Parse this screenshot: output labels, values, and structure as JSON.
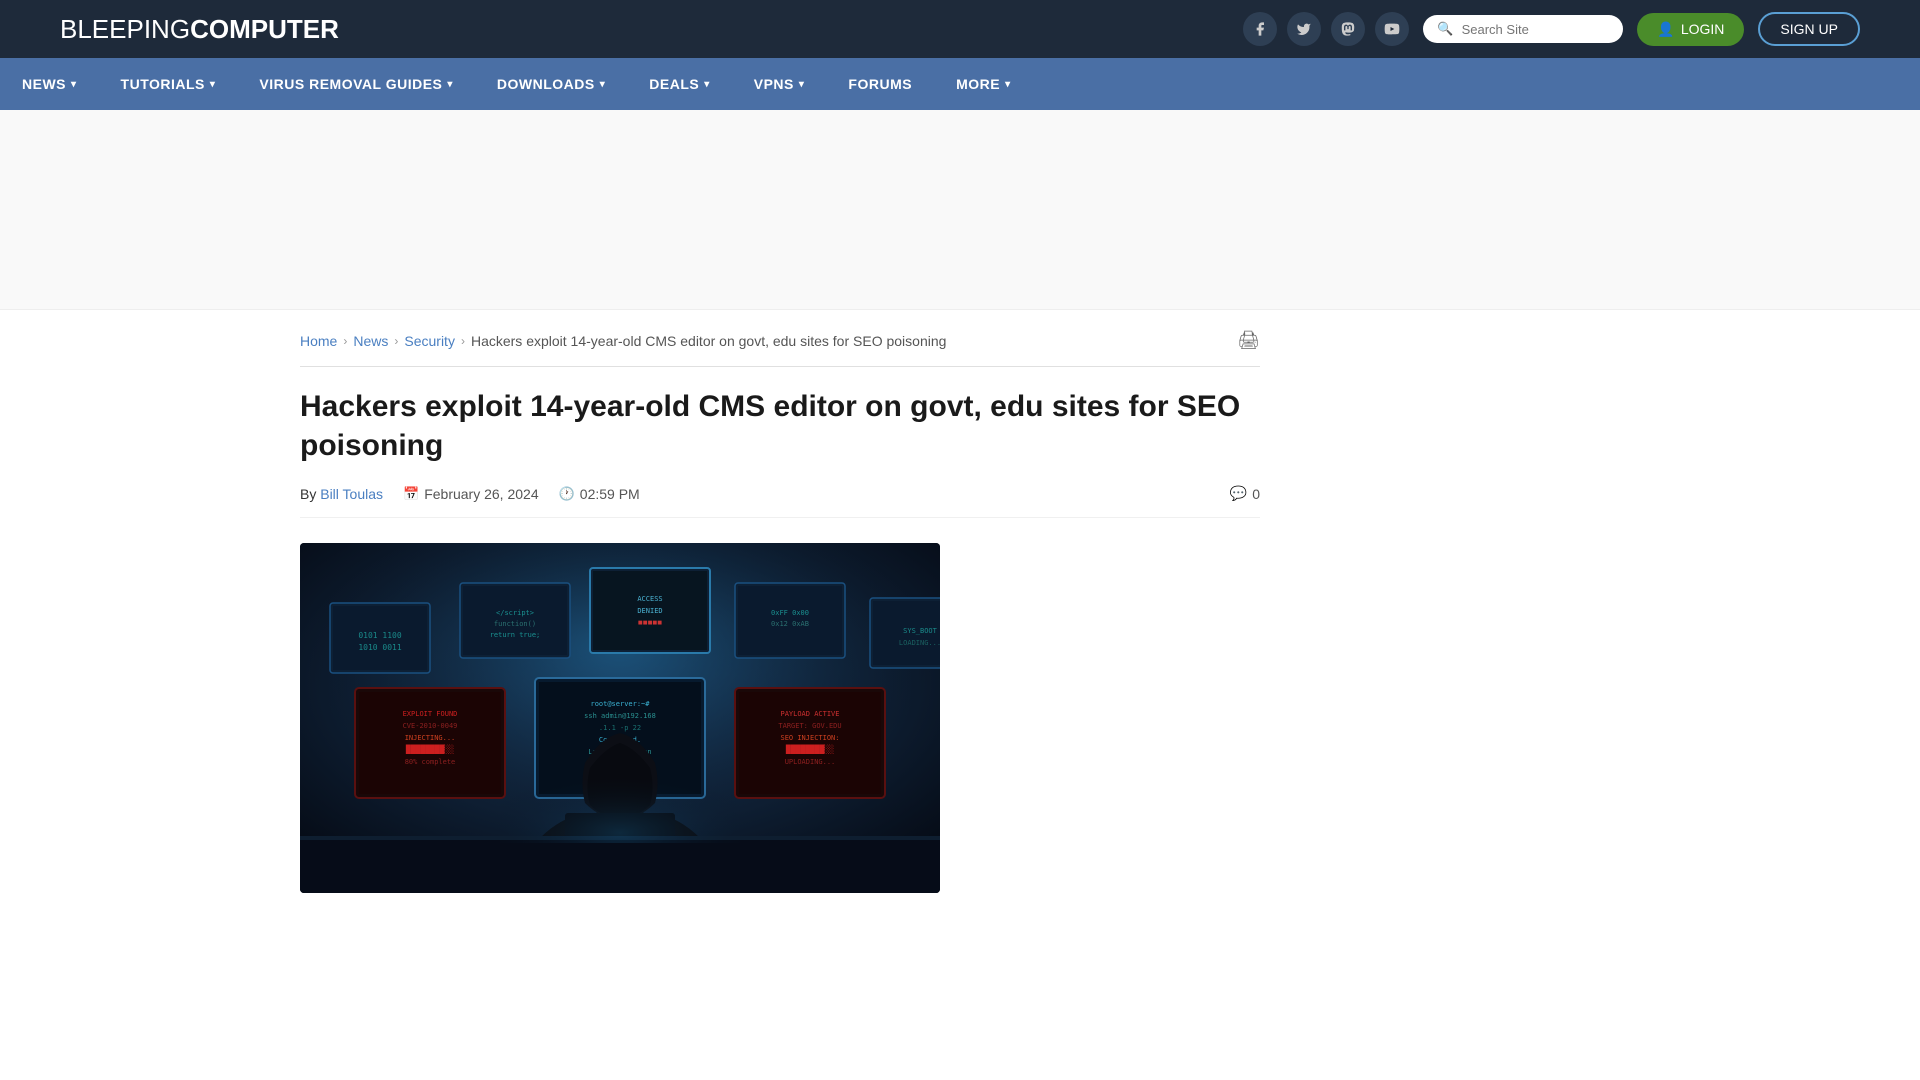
{
  "site": {
    "name_light": "BLEEPING",
    "name_bold": "COMPUTER"
  },
  "header": {
    "search_placeholder": "Search Site",
    "login_label": "LOGIN",
    "signup_label": "SIGN UP",
    "social_icons": [
      {
        "name": "facebook-icon",
        "symbol": "f"
      },
      {
        "name": "twitter-icon",
        "symbol": "𝕏"
      },
      {
        "name": "mastodon-icon",
        "symbol": "m"
      },
      {
        "name": "youtube-icon",
        "symbol": "▶"
      }
    ]
  },
  "nav": {
    "items": [
      {
        "label": "NEWS",
        "has_dropdown": true
      },
      {
        "label": "TUTORIALS",
        "has_dropdown": true
      },
      {
        "label": "VIRUS REMOVAL GUIDES",
        "has_dropdown": true
      },
      {
        "label": "DOWNLOADS",
        "has_dropdown": true
      },
      {
        "label": "DEALS",
        "has_dropdown": true
      },
      {
        "label": "VPNS",
        "has_dropdown": true
      },
      {
        "label": "FORUMS",
        "has_dropdown": false
      },
      {
        "label": "MORE",
        "has_dropdown": true
      }
    ]
  },
  "breadcrumb": {
    "home": "Home",
    "news": "News",
    "security": "Security",
    "current": "Hackers exploit 14-year-old CMS editor on govt, edu sites for SEO poisoning"
  },
  "article": {
    "title": "Hackers exploit 14-year-old CMS editor on govt, edu sites for SEO poisoning",
    "author_label": "By",
    "author_name": "Bill Toulas",
    "date": "February 26, 2024",
    "time": "02:59 PM",
    "comments_count": "0",
    "print_label": "🖨"
  }
}
